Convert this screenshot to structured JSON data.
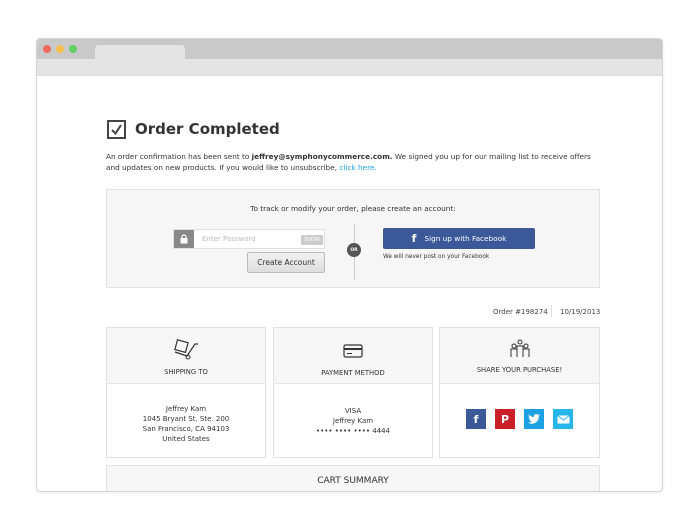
{
  "window": {
    "colors": {
      "close": "#ec6a5e",
      "minimize": "#f4c04f",
      "zoom": "#5fcf66"
    }
  },
  "header": {
    "title": "Order Completed"
  },
  "intro": {
    "text1": "An order confirmation has been sent to ",
    "email": "jeffrey@symphonycommerce.com.",
    "text2": " We signed you up for our mailing list to receive offers and updates on new products. If you would like to unsubscribe, ",
    "link": "click here."
  },
  "account": {
    "prompt": "To track or modify your order, please create an account:",
    "password_placeholder": "Enter Password",
    "show_label": "SHOW",
    "create_label": "Create Account",
    "or_label": "OR",
    "facebook_label": "Sign up with Facebook",
    "facebook_note": "We will never post on your Facebook"
  },
  "order": {
    "number": "Order #198274",
    "date": "10/19/2013"
  },
  "shipping": {
    "label": "SHIPPING TO",
    "lines": [
      "Jeffrey Kam",
      "1045 Bryant St. Ste. 200",
      "San Francisco, CA 94103",
      "United States"
    ]
  },
  "payment": {
    "label": "PAYMENT METHOD",
    "lines": [
      "VISA",
      "Jeffrey Kam",
      "•••• •••• •••• 4444"
    ]
  },
  "share": {
    "label": "SHARE YOUR PURCHASE!",
    "colors": {
      "facebook": "#3b5998",
      "pinterest": "#cb2027",
      "twitter": "#1da1e2",
      "email": "#27b6ea"
    }
  },
  "cart": {
    "label": "CART SUMMARY"
  }
}
